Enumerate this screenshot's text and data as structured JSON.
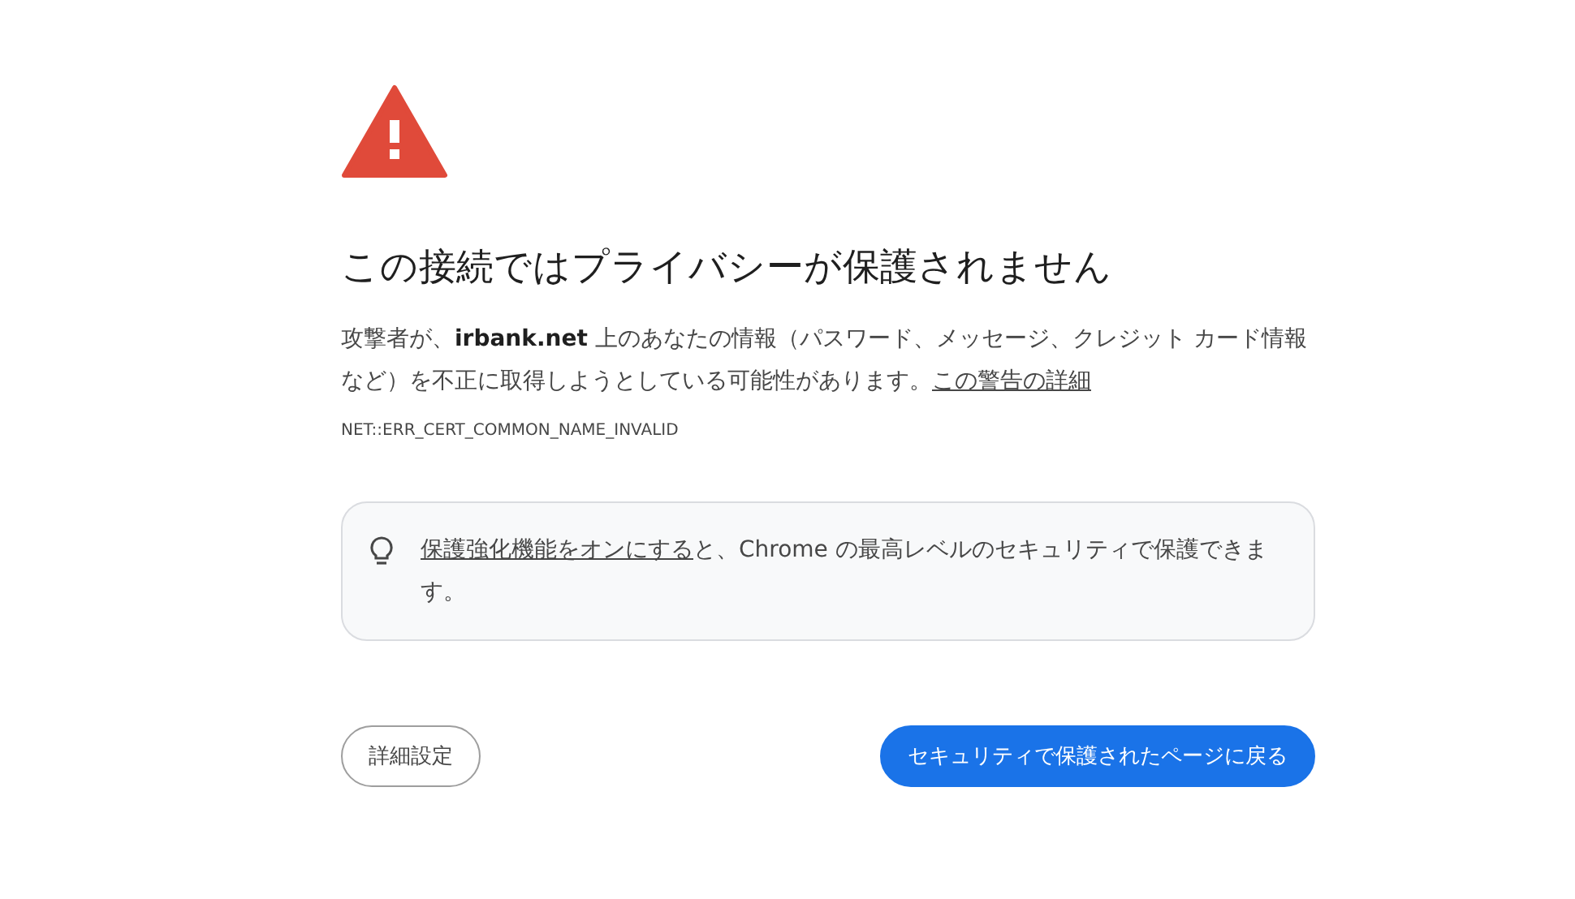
{
  "heading": "この接続ではプライバシーが保護されません",
  "message": {
    "text": "攻撃者が、**irbank.net** 上のあなたの情報（パスワード、メッセージ、クレジット カード情報など）を不正に取得しようとしている可能性があります。",
    "link": "この警告の詳細"
  },
  "error_code": "NET::ERR_CERT_COMMON_NAME_INVALID",
  "tip": {
    "link": "保護強化機能をオンにする",
    "text": "と、Chrome の最高レベルのセキュリティで保護できます。"
  },
  "buttons": [
    {
      "label": "詳細設定",
      "kind": "secondary"
    },
    {
      "label": "セキュリティで保護されたページに戻る",
      "kind": "primary"
    }
  ]
}
